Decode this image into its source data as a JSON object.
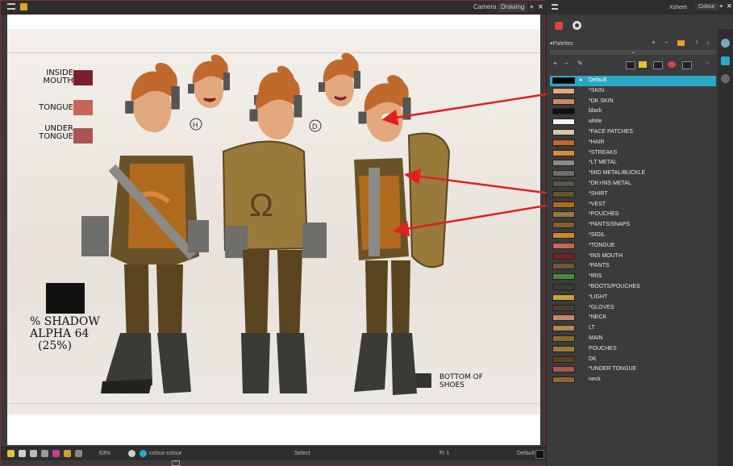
{
  "viewport": {
    "tabs": [
      "Camera",
      "Drawing"
    ],
    "annotations": {
      "inside_mouth": "INSIDE MOUTH",
      "tongue": "TONGUE",
      "under_tongue": "UNDER TONGUE",
      "shadow_line1": "% SHADOW",
      "shadow_line2": "ALPHA 64",
      "shadow_line3": "(25%)",
      "bottom_of_shoes": "BOTTOM OF SHOES",
      "head_label_h": "H",
      "head_label_d": "D"
    },
    "colors": {
      "inside_mouth": "#7a1f2b",
      "tongue": "#c7655a",
      "under_tongue": "#a9554f",
      "shadow": "#111111",
      "shoe_bottom": "#333333"
    },
    "status": {
      "zoom": "63%",
      "tool": "colour-colour",
      "select": "Select",
      "frame": "Fr 1",
      "palette": "Default"
    }
  },
  "panel": {
    "tabs": [
      "Xsheet",
      "Colour"
    ],
    "palettes_label": "Palettes",
    "colours": [
      {
        "name": "Default",
        "color": "#000000",
        "selected": true
      },
      {
        "name": "*SKIN",
        "color": "#e3a87d"
      },
      {
        "name": "*DK SKIN",
        "color": "#c98a68"
      },
      {
        "name": "black",
        "color": "#111111"
      },
      {
        "name": "white",
        "color": "#f5f5f5"
      },
      {
        "name": "*FACE PATCHES",
        "color": "#cfc9b0"
      },
      {
        "name": "*HAIR",
        "color": "#c0692c"
      },
      {
        "name": "*STREAKS",
        "color": "#d98a3d"
      },
      {
        "name": "*LT METAL",
        "color": "#8a8a86"
      },
      {
        "name": "*MID METAL/BUCKLE",
        "color": "#6e6e6a"
      },
      {
        "name": "*DK+INS METAL",
        "color": "#555551"
      },
      {
        "name": "*SHIRT",
        "color": "#6a5228"
      },
      {
        "name": "*VEST",
        "color": "#b06a1e"
      },
      {
        "name": "*POUCHES",
        "color": "#9a7a3a"
      },
      {
        "name": "*PANTS/SNAPS",
        "color": "#84602a"
      },
      {
        "name": "*SIGIL",
        "color": "#c98a2c"
      },
      {
        "name": "*TONGUE",
        "color": "#c7655a"
      },
      {
        "name": "*INS MOUTH",
        "color": "#7a1f2b"
      },
      {
        "name": "*PANTS",
        "color": "#6b5a3a"
      },
      {
        "name": "*IRIS",
        "color": "#4a8a3a"
      },
      {
        "name": "*BOOTS/POUCHES",
        "color": "#3a3a36"
      },
      {
        "name": "*LIGHT",
        "color": "#c9a33a"
      },
      {
        "name": "*GLOVES",
        "color": "#4b3f2a"
      },
      {
        "name": "*NECK",
        "color": "#c98a68"
      },
      {
        "name": "LT",
        "color": "#b08a4a"
      },
      {
        "name": "MAIN",
        "color": "#8a6a2a"
      },
      {
        "name": "POUCHES",
        "color": "#9a7a3a"
      },
      {
        "name": "DK",
        "color": "#5a4420"
      },
      {
        "name": "*UNDER TONGUE",
        "color": "#a9554f"
      },
      {
        "name": "neck",
        "color": "#8a6a2a"
      }
    ]
  }
}
